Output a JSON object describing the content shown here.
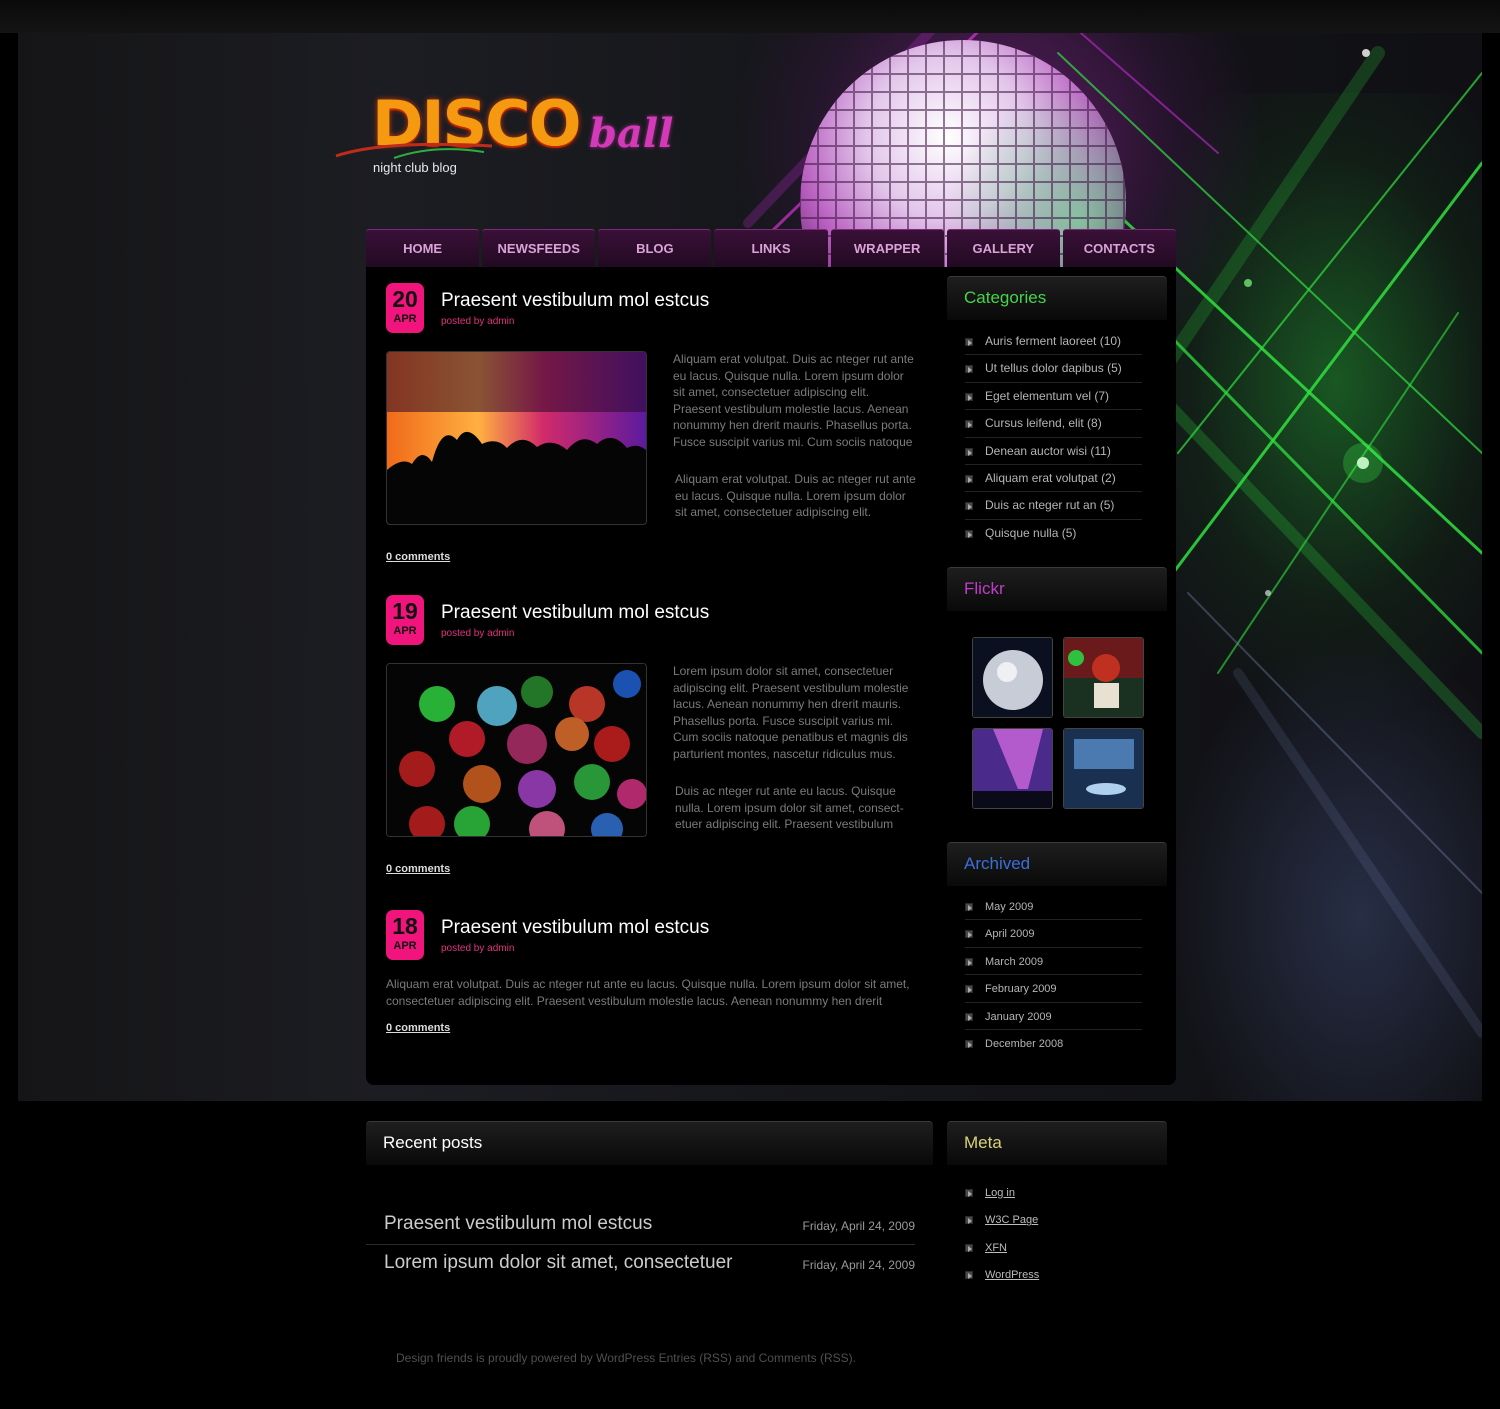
{
  "brand": {
    "logo_word": "DISCO",
    "logo_word_2": "ball",
    "tagline": "night club blog"
  },
  "nav": {
    "items": [
      "HOME",
      "NEWSFEEDS",
      "BLOG",
      "LINKS",
      "WRAPPER",
      "GALLERY",
      "CONTACTS"
    ]
  },
  "posts": [
    {
      "day": "20",
      "month": "APR",
      "title": "Praesent vestibulum mol estcus",
      "byline": "posted by admin",
      "para1": "Aliquam erat volutpat. Duis ac nteger rut ante eu lacus.  Quisque nulla.  Lorem ipsum dolor sit amet, consectetuer adipiscing elit. Praesent vestibulum molestie lacus. Aenean nonummy hen drerit mauris. Phasellus porta. Fusce suscipit varius mi. Cum sociis natoque",
      "para2": "Aliquam erat volutpat. Duis ac nteger rut ante eu lacus.  Quisque nulla.  Lorem ipsum dolor sit amet, consectetuer adipiscing elit.",
      "comments": "0 comments"
    },
    {
      "day": "19",
      "month": "APR",
      "title": "Praesent vestibulum mol estcus",
      "byline": "posted by admin",
      "para1": "Lorem ipsum dolor sit amet, consectetuer adipiscing elit. Praesent vestibulum molestie lacus. Aenean nonummy hen drerit mauris. Phasellus porta. Fusce suscipit varius mi. Cum sociis natoque  penatibus et magnis dis parturient montes, nascetur ridiculus mus.",
      "para2": "Duis ac nteger rut ante eu lacus.  Quisque nulla.  Lorem ipsum dolor sit amet, consect-etuer adipiscing elit. Praesent vestibulum",
      "comments": "0 comments"
    },
    {
      "day": "18",
      "month": "APR",
      "title": "Praesent vestibulum mol estcus",
      "byline": "posted by admin",
      "para1": "Aliquam erat volutpat. Duis ac nteger rut ante eu lacus.  Quisque nulla.  Lorem ipsum dolor sit amet, consectetuer adipiscing elit. Praesent vestibulum molestie lacus. Aenean nonummy hen drerit",
      "comments": "0 comments"
    }
  ],
  "categories": {
    "title": "Categories",
    "items": [
      "Auris ferment laoreet (10)",
      "Ut tellus dolor dapibus (5)",
      "Eget elementum vel  (7)",
      "Cursus leifend, elit (8)",
      "Denean auctor wisi (11)",
      "Aliquam erat volutpat (2)",
      "Duis ac nteger rut an (5)",
      "Quisque nulla (5)"
    ]
  },
  "flickr": {
    "title": "Flickr"
  },
  "archived": {
    "title": "Archived",
    "items": [
      "May 2009",
      "April 2009",
      "March 2009",
      "February 2009",
      "January 2009",
      "December 2008"
    ]
  },
  "recent": {
    "title": "Recent posts",
    "items": [
      {
        "title": "Praesent vestibulum mol estcus",
        "date": "Friday, April 24, 2009"
      },
      {
        "title": "Lorem ipsum dolor sit amet, consectetuer",
        "date": "Friday, April 24, 2009"
      }
    ]
  },
  "meta": {
    "title": "Meta",
    "items": [
      "Log in",
      "W3C Page",
      "XFN",
      "WordPress"
    ]
  },
  "footer": {
    "text": "Design friends is proudly powered by WordPress  Entries (RSS)  and Comments (RSS)."
  },
  "colors": {
    "accent_pink": "#f0147c",
    "categories_title": "#45d44a",
    "flickr_title": "#c13cc8",
    "archived_title": "#3b6fd8",
    "meta_title": "#d9d27a",
    "nav_text": "#d9a3d6"
  }
}
